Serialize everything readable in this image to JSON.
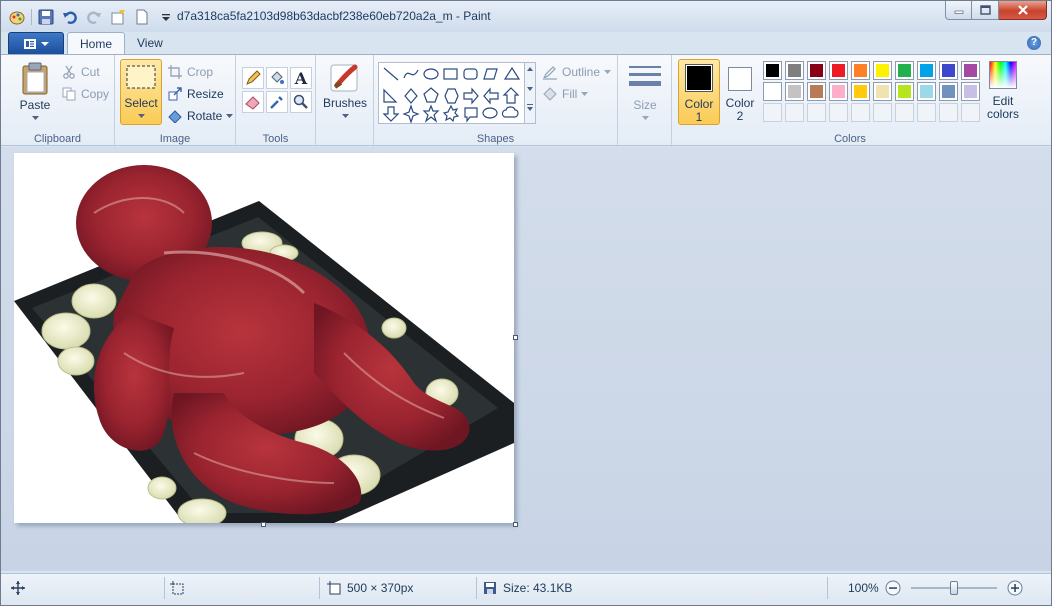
{
  "window": {
    "title": "d7a318ca5fa2103d98b63dacbf238e60eb720a2a_m - Paint"
  },
  "quick_access": {
    "icons": [
      "paint-app-icon",
      "save-icon",
      "undo-icon",
      "redo-icon",
      "new-icon",
      "document-icon",
      "customize-arrow-icon"
    ]
  },
  "tabs": {
    "app_menu_icon": "app-menu-icon",
    "home": "Home",
    "view": "View",
    "help": "?"
  },
  "clipboard": {
    "paste": "Paste",
    "cut": "Cut",
    "copy": "Copy",
    "label": "Clipboard"
  },
  "image": {
    "select": "Select",
    "crop": "Crop",
    "resize": "Resize",
    "rotate": "Rotate",
    "label": "Image"
  },
  "tools": {
    "label": "Tools"
  },
  "brushes": {
    "label": "Brushes"
  },
  "shapes": {
    "label": "Shapes",
    "outline": "Outline",
    "fill": "Fill"
  },
  "size": {
    "label": "Size"
  },
  "colors": {
    "color1_label": "Color",
    "color1_num": "1",
    "color2_label": "Color",
    "color2_num": "2",
    "edit_colors_line1": "Edit",
    "edit_colors_line2": "colors",
    "label": "Colors",
    "color1": "#000000",
    "color2": "#ffffff",
    "palette_row1": [
      "#000000",
      "#7f7f7f",
      "#880015",
      "#ed1c24",
      "#ff7f27",
      "#fff200",
      "#22b14c",
      "#00a2e8",
      "#3f48cc",
      "#a349a4"
    ],
    "palette_row2": [
      "#ffffff",
      "#c3c3c3",
      "#b97a57",
      "#ffaec9",
      "#ffc90e",
      "#efe4b0",
      "#b5e61d",
      "#99d9ea",
      "#7092be",
      "#c8bfe7"
    ]
  },
  "status": {
    "dimensions": "500 × 370px",
    "size": "Size: 43.1KB",
    "zoom": "100%",
    "zoom_level": 1.0
  }
}
